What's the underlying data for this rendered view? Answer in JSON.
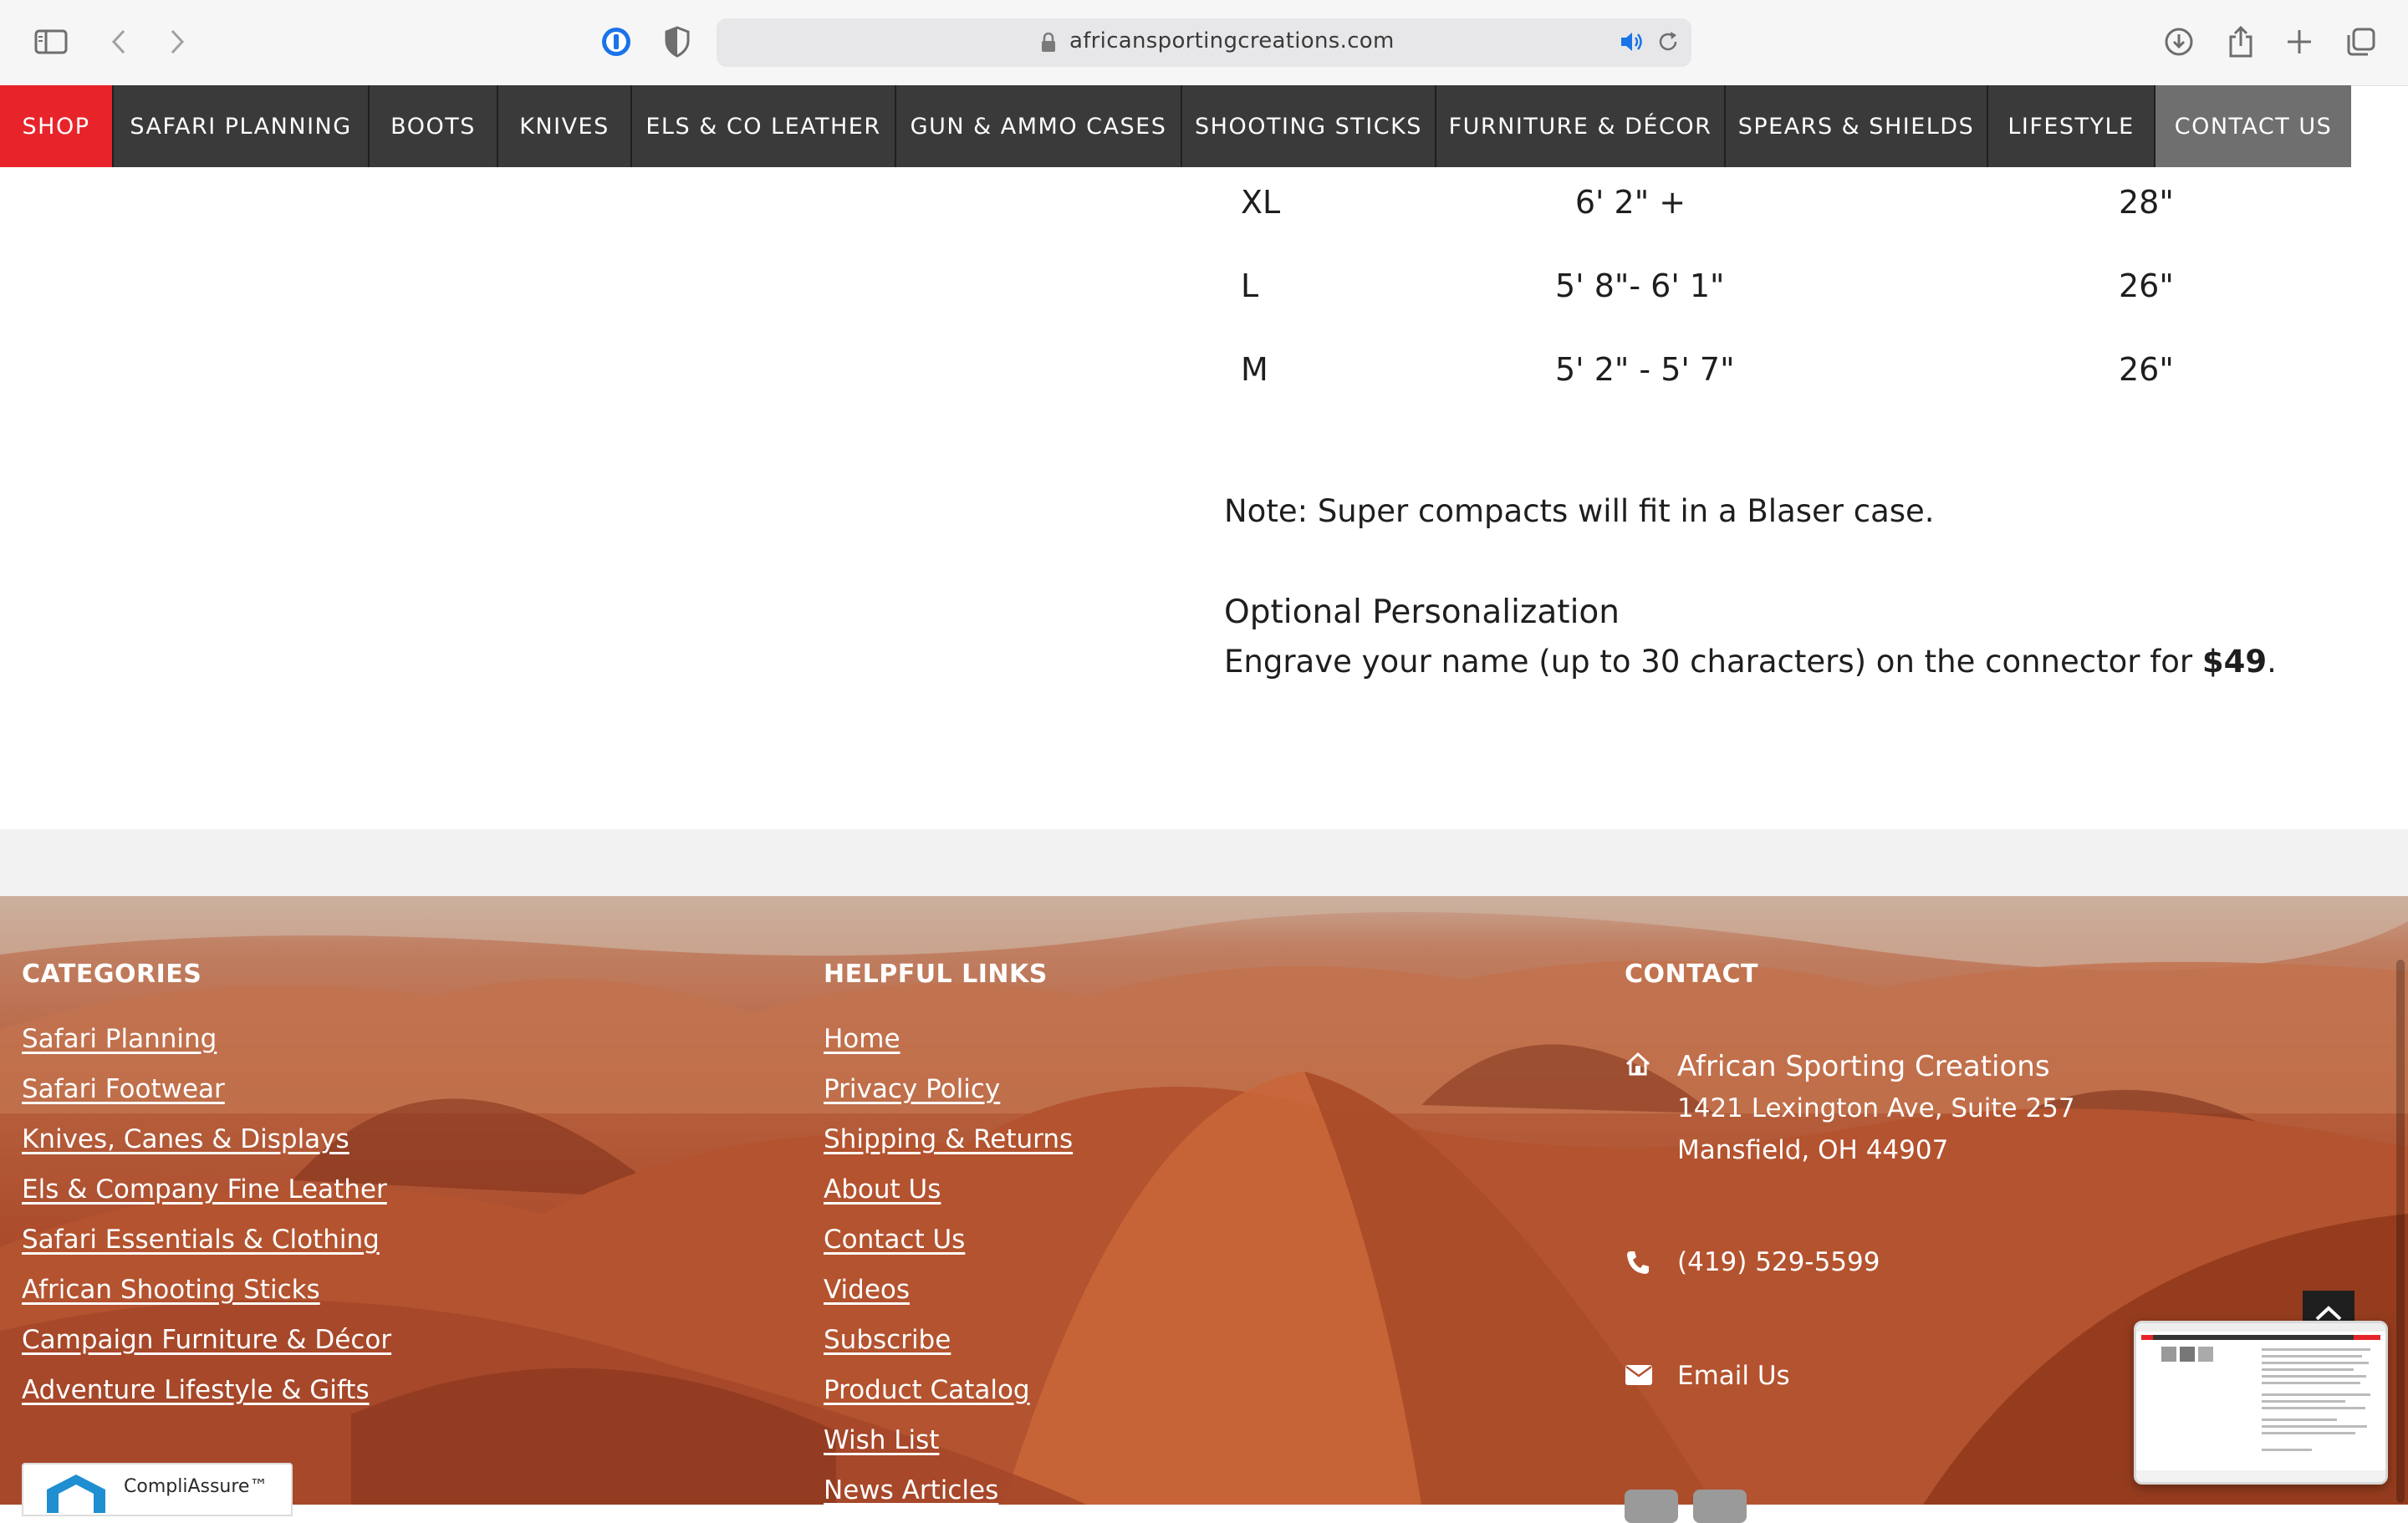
{
  "browser": {
    "url": "africansportingcreations.com",
    "icons": [
      "sidebar-icon",
      "back-icon",
      "forward-icon",
      "password-icon",
      "shield-icon",
      "lock-icon",
      "speaker-icon",
      "reload-icon",
      "download-icon",
      "share-icon",
      "new-tab-icon",
      "tabs-overview-icon"
    ]
  },
  "nav": {
    "items": [
      "SHOP",
      "SAFARI PLANNING",
      "BOOTS",
      "KNIVES",
      "ELS & CO LEATHER",
      "GUN & AMMO CASES",
      "SHOOTING STICKS",
      "FURNITURE & DÉCOR",
      "SPEARS & SHIELDS",
      "LIFESTYLE",
      "CONTACT US"
    ]
  },
  "sizes": [
    {
      "size": "XL",
      "height": "6' 2\" +",
      "length": "28\""
    },
    {
      "size": "L",
      "height": "5' 8\"- 6' 1\"",
      "length": "26\""
    },
    {
      "size": "M",
      "height": "5' 2\" - 5' 7\"",
      "length": "26\""
    }
  ],
  "note": "Note: Super compacts will fit in a Blaser case.",
  "personalization": {
    "title": "Optional Personalization",
    "body_prefix": "Engrave your name (up to 30 characters) on the connector for ",
    "price": "$49",
    "body_suffix": "."
  },
  "footer": {
    "categories": {
      "title": "CATEGORIES",
      "links": [
        "Safari Planning",
        "Safari Footwear",
        "Knives, Canes & Displays",
        "Els & Company Fine Leather",
        "Safari Essentials & Clothing",
        "African Shooting Sticks",
        "Campaign Furniture & Décor",
        "Adventure Lifestyle & Gifts"
      ]
    },
    "helpful": {
      "title": "HELPFUL LINKS",
      "links": [
        "Home",
        "Privacy Policy",
        "Shipping & Returns",
        "About Us",
        "Contact Us",
        "Videos",
        "Subscribe",
        "Product Catalog",
        "Wish List",
        "News Articles"
      ]
    },
    "contact": {
      "title": "CONTACT",
      "company": "African Sporting Creations",
      "address1": "1421 Lexington Ave, Suite 257",
      "address2": "Mansfield, OH 44907",
      "phone": "(419) 529-5599",
      "email": "Email Us"
    },
    "badge": "CompliAssure™"
  },
  "colors": {
    "nav_bg": "#3a3a3a",
    "shop_red": "#e8242b",
    "contact_gray": "#6f6f6f"
  }
}
